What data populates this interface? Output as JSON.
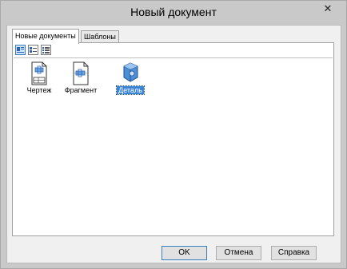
{
  "window": {
    "title": "Новый документ"
  },
  "tabs": [
    {
      "label": "Новые документы",
      "active": true
    },
    {
      "label": "Шаблоны",
      "active": false
    }
  ],
  "view_modes": [
    "large-icons",
    "small-icons",
    "list"
  ],
  "documents": [
    {
      "label": "Чертеж",
      "icon": "drawing-icon",
      "selected": false
    },
    {
      "label": "Фрагмент",
      "icon": "fragment-icon",
      "selected": false
    },
    {
      "label": "Деталь",
      "icon": "part-icon",
      "selected": true
    }
  ],
  "buttons": {
    "ok": "OK",
    "cancel": "Отмена",
    "help": "Справка"
  },
  "colors": {
    "selection": "#3c84d6",
    "titlebar": "#c9c9c9",
    "accent": "#3c7fc1"
  }
}
